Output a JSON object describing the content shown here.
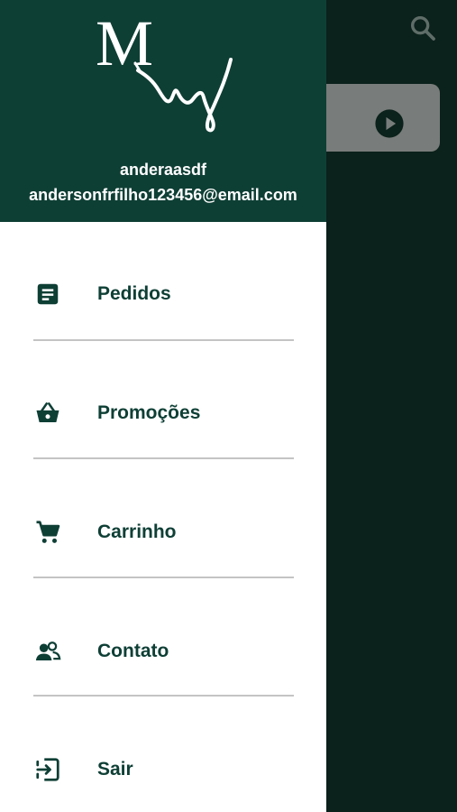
{
  "drawer": {
    "user_name": "anderaasdf",
    "user_email": "andersonfrfilho123456@email.com",
    "items": [
      {
        "label": "Pedidos",
        "icon": "receipt-icon"
      },
      {
        "label": "Promoções",
        "icon": "basket-icon"
      },
      {
        "label": "Carrinho",
        "icon": "cart-icon"
      },
      {
        "label": "Contato",
        "icon": "contacts-icon"
      },
      {
        "label": "Sair",
        "icon": "logout-icon"
      }
    ]
  },
  "background": {
    "search_icon": "search-icon",
    "play_icon": "play-circle-icon"
  },
  "colors": {
    "drawer_header": "#0e3f35",
    "overlay": "#0b211b",
    "text_primary": "#0e3f35",
    "divider": "#c4c4c4"
  }
}
